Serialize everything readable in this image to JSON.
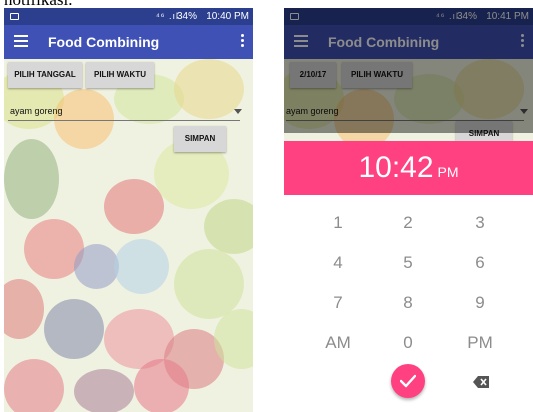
{
  "caption": "notifikasi.",
  "left_screen": {
    "status_bar": {
      "signal_icons": "⁴⁶ .ıl",
      "battery": "34%",
      "time": "10:40 PM"
    },
    "app_bar": {
      "title": "Food Combining"
    },
    "buttons": {
      "date": "PILIH TANGGAL",
      "time": "PILIH WAKTU",
      "save": "SIMPAN"
    },
    "food_select": {
      "value": "ayam goreng"
    }
  },
  "right_screen": {
    "status_bar": {
      "signal_icons": "⁴⁶ .ıl",
      "battery": "34%",
      "time": "10:41 PM"
    },
    "app_bar": {
      "title": "Food Combining"
    },
    "buttons": {
      "date": "2/10/17",
      "time": "PILIH WAKTU",
      "save": "SIMPAN"
    },
    "food_select": {
      "value": "ayam goreng"
    },
    "time_picker": {
      "time": "10:42",
      "ampm": "PM",
      "keys": [
        "1",
        "2",
        "3",
        "4",
        "5",
        "6",
        "7",
        "8",
        "9",
        "AM",
        "0",
        "PM"
      ],
      "accent_color": "#ff4081"
    }
  },
  "icons": {
    "menu": "hamburger-icon",
    "overflow": "more-vert-icon",
    "confirm": "check-icon",
    "backspace": "backspace-icon"
  },
  "colors": {
    "app_bar": "#3f51b5",
    "status_bar": "#2c3f8e",
    "picker": "#ff4081"
  }
}
